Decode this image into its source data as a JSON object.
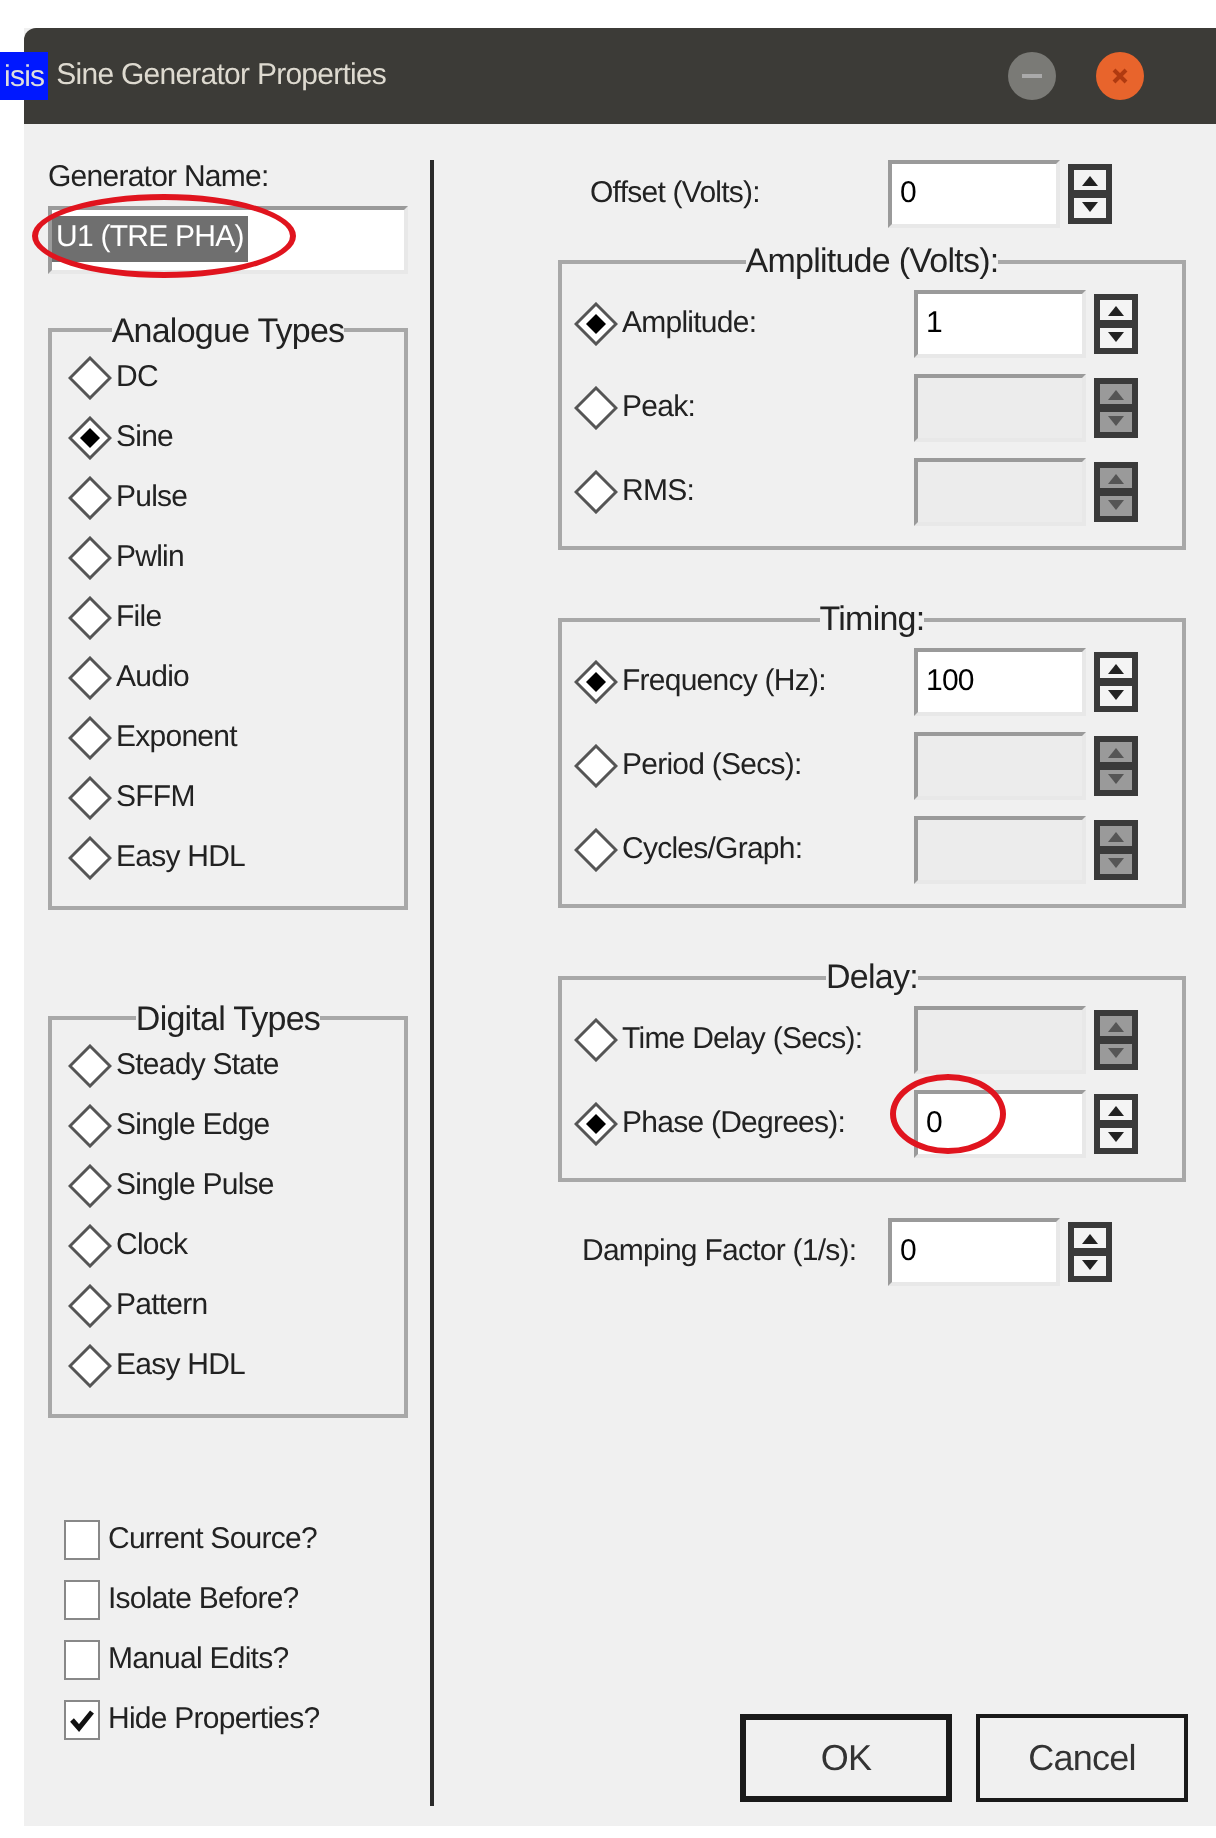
{
  "window": {
    "title": "Sine Generator Properties",
    "app_icon_text": "isis"
  },
  "generator_name": {
    "label": "Generator Name:",
    "value": "U1 (TRE PHA)",
    "text_selected": true,
    "annotated": true
  },
  "analogue_types": {
    "title": "Analogue Types",
    "options": [
      {
        "label": "DC",
        "selected": false
      },
      {
        "label": "Sine",
        "selected": true
      },
      {
        "label": "Pulse",
        "selected": false
      },
      {
        "label": "Pwlin",
        "selected": false
      },
      {
        "label": "File",
        "selected": false
      },
      {
        "label": "Audio",
        "selected": false
      },
      {
        "label": "Exponent",
        "selected": false
      },
      {
        "label": "SFFM",
        "selected": false
      },
      {
        "label": "Easy HDL",
        "selected": false
      }
    ]
  },
  "digital_types": {
    "title": "Digital Types",
    "options": [
      {
        "label": "Steady State",
        "selected": false
      },
      {
        "label": "Single Edge",
        "selected": false
      },
      {
        "label": "Single Pulse",
        "selected": false
      },
      {
        "label": "Clock",
        "selected": false
      },
      {
        "label": "Pattern",
        "selected": false
      },
      {
        "label": "Easy HDL",
        "selected": false
      }
    ]
  },
  "options": [
    {
      "label": "Current Source?",
      "checked": false
    },
    {
      "label": "Isolate Before?",
      "checked": false
    },
    {
      "label": "Manual Edits?",
      "checked": false
    },
    {
      "label": "Hide Properties?",
      "checked": true
    }
  ],
  "offset": {
    "label": "Offset (Volts):",
    "value": "0"
  },
  "groups": [
    {
      "title": "Amplitude (Volts):",
      "rows": [
        {
          "label": "Amplitude:",
          "selected": true,
          "disabled": false,
          "value": "1",
          "annotated": false
        },
        {
          "label": "Peak:",
          "selected": false,
          "disabled": true,
          "annotated": false
        },
        {
          "label": "RMS:",
          "selected": false,
          "disabled": true,
          "annotated": false
        }
      ]
    },
    {
      "title": "Timing:",
      "rows": [
        {
          "label": "Frequency (Hz):",
          "selected": true,
          "disabled": false,
          "value": "100",
          "annotated": false
        },
        {
          "label": "Period (Secs):",
          "selected": false,
          "disabled": true,
          "annotated": false
        },
        {
          "label": "Cycles/Graph:",
          "selected": false,
          "disabled": true,
          "annotated": false
        }
      ]
    },
    {
      "title": "Delay:",
      "rows": [
        {
          "label": "Time Delay (Secs):",
          "selected": false,
          "disabled": true,
          "annotated": false
        },
        {
          "label": "Phase (Degrees):",
          "selected": true,
          "disabled": false,
          "value": "0",
          "annotated": true
        }
      ]
    }
  ],
  "damping": {
    "label": "Damping Factor (1/s):",
    "value": "0"
  },
  "buttons": [
    {
      "label": "OK",
      "default": true
    },
    {
      "label": "Cancel",
      "default": false
    }
  ]
}
